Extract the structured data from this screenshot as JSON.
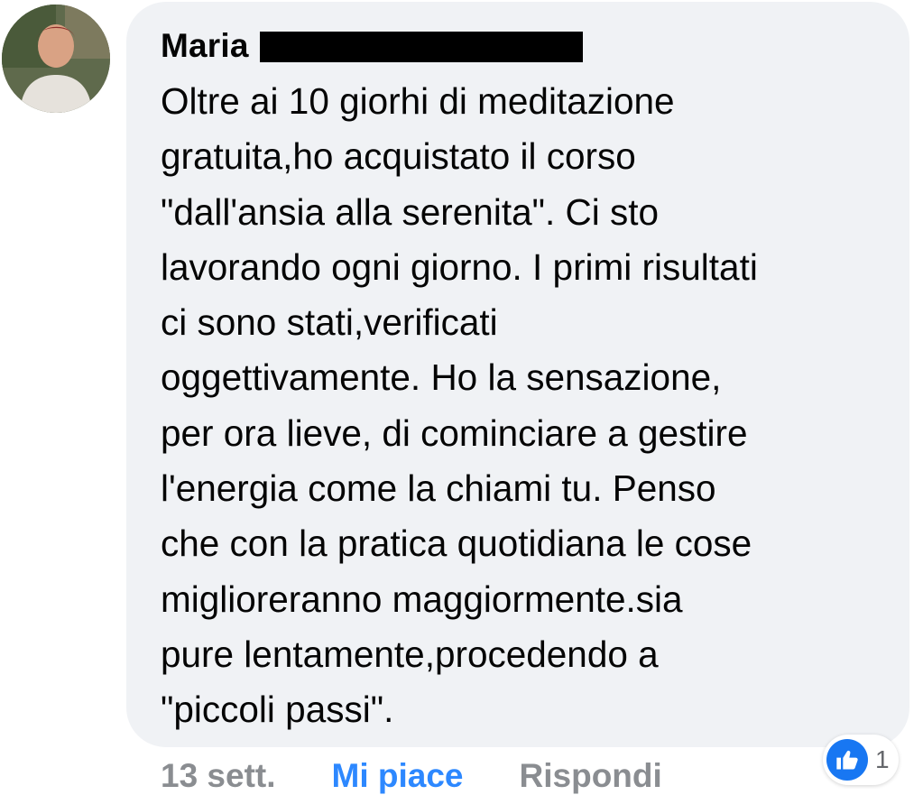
{
  "comment": {
    "author": "Maria",
    "text": "Oltre ai 10 giorhi di meditazione\ngratuita,ho acquistato il corso\n\"dall'ansia alla serenita\". Ci sto\nlavorando ogni giorno. I primi risultati\nci sono stati,verificati\noggettivamente. Ho la sensazione,\nper ora lieve, di cominciare a gestire\nl'energia come la chiami tu. Penso\nche con la pratica quotidiana le cose\nmiglioreranno maggiormente.sia\npure lentamente,procedendo a\n\"piccoli passi\"."
  },
  "actions": {
    "timestamp": "13 sett.",
    "like_label": "Mi piace",
    "reply_label": "Rispondi"
  },
  "reactions": {
    "icon": "thumbs-up-icon",
    "count": "1"
  },
  "colors": {
    "bubble": "#f0f2f5",
    "like_blue": "#2d88ff",
    "muted_gray": "#8a8d91"
  }
}
